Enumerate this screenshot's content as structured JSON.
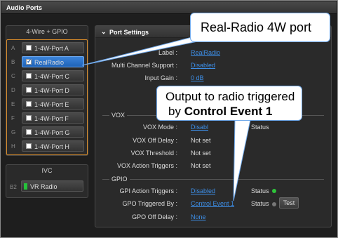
{
  "window": {
    "title": "Audio Ports"
  },
  "four_wire": {
    "header": "4-Wire + GPIO",
    "rows": [
      {
        "letter": "A",
        "label": "1-4W-Port A",
        "checked": false,
        "selected": false
      },
      {
        "letter": "B",
        "label": "RealRadio",
        "checked": true,
        "selected": true
      },
      {
        "letter": "C",
        "label": "1-4W-Port C",
        "checked": false,
        "selected": false
      },
      {
        "letter": "D",
        "label": "1-4W-Port D",
        "checked": false,
        "selected": false
      },
      {
        "letter": "E",
        "label": "1-4W-Port E",
        "checked": false,
        "selected": false
      },
      {
        "letter": "F",
        "label": "1-4W-Port F",
        "checked": false,
        "selected": false
      },
      {
        "letter": "G",
        "label": "1-4W-Port G",
        "checked": false,
        "selected": false
      },
      {
        "letter": "H",
        "label": "1-4W-Port H",
        "checked": false,
        "selected": false
      }
    ]
  },
  "ivc": {
    "header": "IVC",
    "row": {
      "letter": "B2",
      "label": "VR Radio"
    }
  },
  "port_settings": {
    "title": "Port Settings",
    "label_lbl": "Label :",
    "label_val": "RealRadio",
    "multi_lbl": "Multi Channel Support :",
    "multi_val": "Disabled",
    "gain_lbl": "Input Gain :",
    "gain_val": "0 dB",
    "vox": {
      "section": "VOX",
      "mode_lbl": "VOX Mode :",
      "mode_val": "Disabl",
      "status_lbl": "Status",
      "offdelay_lbl": "VOX Off Delay :",
      "offdelay_val": "Not set",
      "threshold_lbl": "VOX Threshold :",
      "threshold_val": "Not set",
      "triggers_lbl": "VOX Action Triggers :",
      "triggers_val": "Not set"
    },
    "gpio": {
      "section": "GPIO",
      "gpi_lbl": "GPI Action Triggers :",
      "gpi_val": "Disabled",
      "gpi_status_lbl": "Status",
      "gpo_lbl": "GPO Triggered By :",
      "gpo_val": "Control Event 1",
      "gpo_status_lbl": "Status",
      "test_label": "Test",
      "gpo_off_lbl": "GPO Off Delay :",
      "gpo_off_val": "None"
    }
  },
  "callouts": {
    "top": "Real-Radio 4W port",
    "bottom_line1": "Output to radio triggered",
    "bottom_line2_prefix": "by ",
    "bottom_line2_bold": "Control Event 1"
  },
  "colors": {
    "accent_orange": "#d58a2a",
    "selected_blue": "#2a73cc",
    "link_blue": "#3d8fe8",
    "status_green": "#2ec43a"
  }
}
